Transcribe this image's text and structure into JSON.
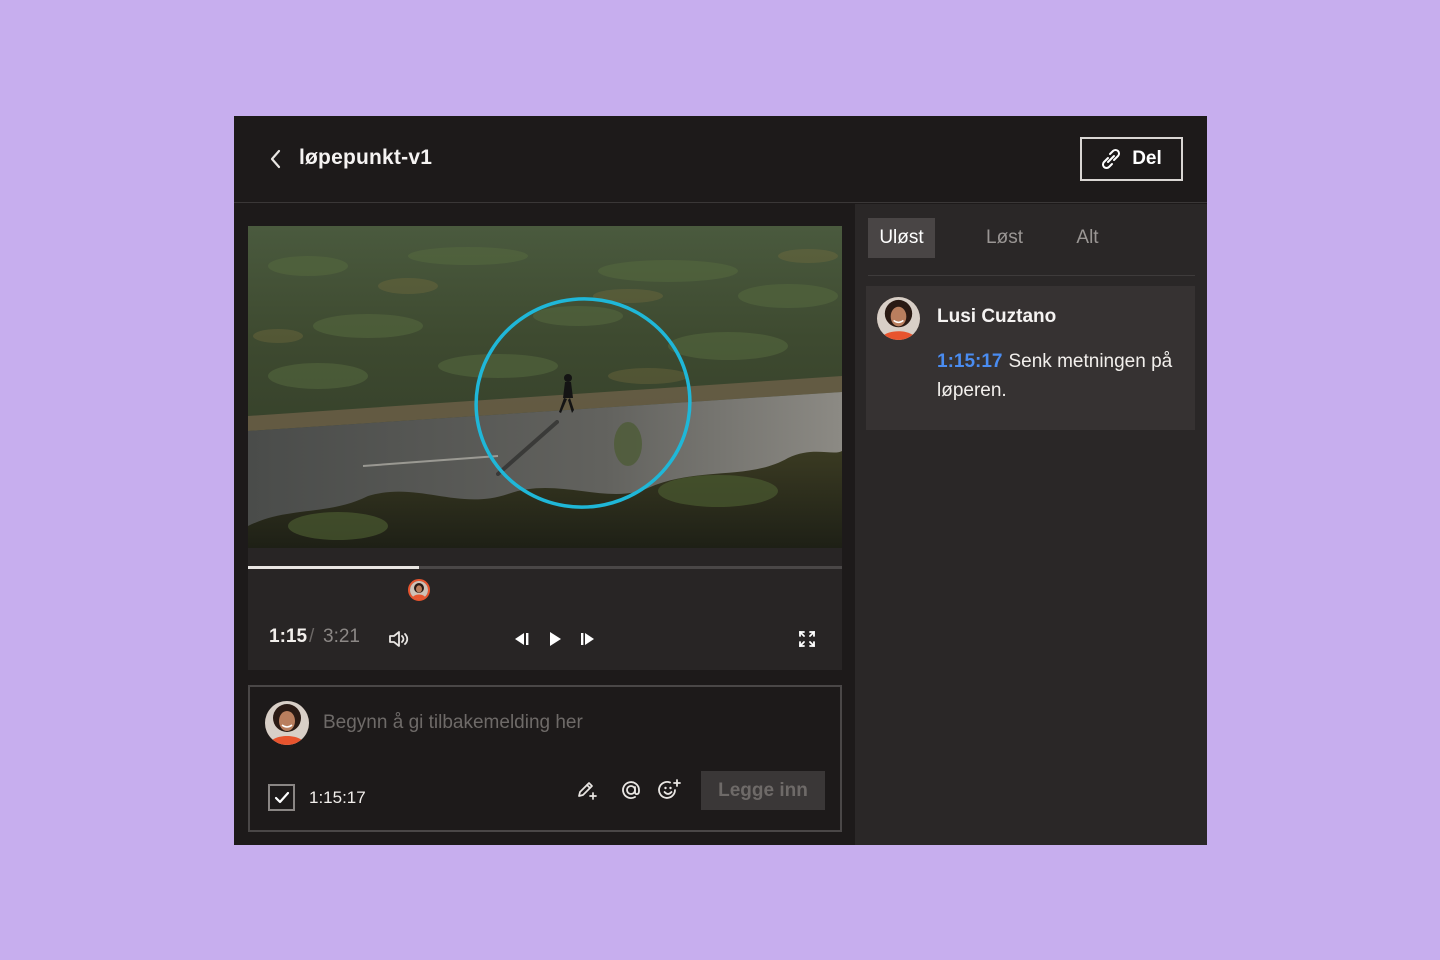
{
  "header": {
    "title": "løpepunkt-v1",
    "share_label": "Del"
  },
  "player": {
    "current_time": "1:15",
    "separator": "/",
    "total_time": "3:21",
    "progress": 0.288
  },
  "composer": {
    "placeholder": "Begynn å gi tilbakemelding her",
    "timestamp": "1:15:17",
    "timestamp_checked": true,
    "submit_label": "Legge inn"
  },
  "sidebar": {
    "tabs": [
      {
        "label": "Uløst",
        "active": true
      },
      {
        "label": "Løst",
        "active": false
      },
      {
        "label": "Alt",
        "active": false
      }
    ],
    "comments": [
      {
        "author": "Lusi Cuztano",
        "timestamp": "1:15:17",
        "text": "Senk metningen på løperen."
      }
    ]
  },
  "colors": {
    "background": "#c7aeee",
    "annotation_circle": "#1fb7d8",
    "timestamp_link": "#4a8cf0",
    "marker_ring": "#e8542e"
  },
  "icons": [
    "chevron-left-icon",
    "link-icon",
    "volume-icon",
    "step-back-icon",
    "play-icon",
    "step-forward-icon",
    "fullscreen-icon",
    "draw-icon",
    "mention-icon",
    "emoji-add-icon",
    "check-icon"
  ]
}
